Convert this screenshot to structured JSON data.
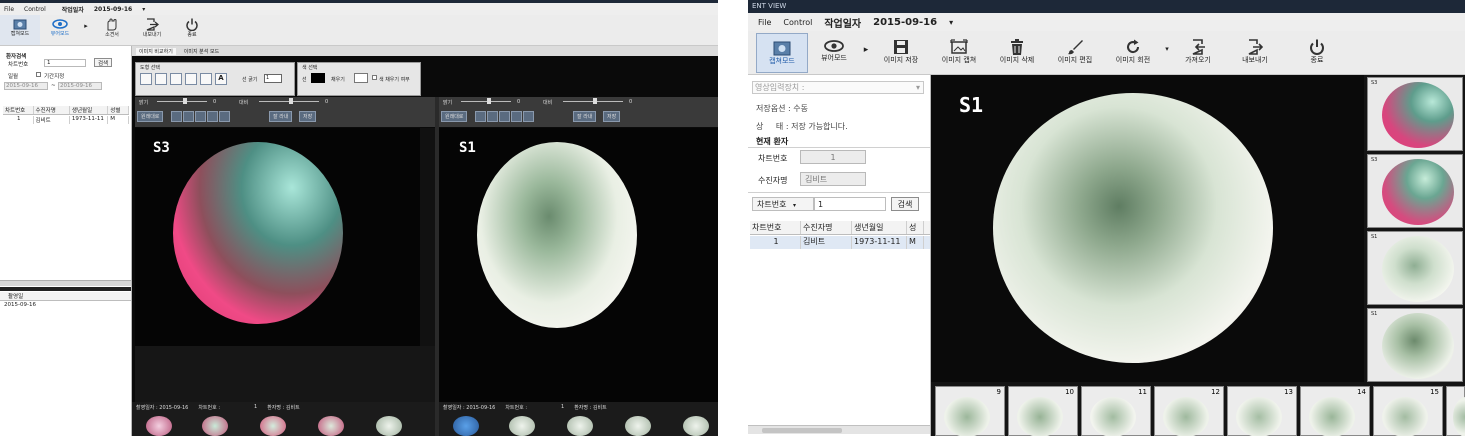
{
  "left_screen": {
    "menu": [
      "File",
      "Control"
    ],
    "work_date_label": "작업일자",
    "work_date_value": "2015-09-16",
    "toolbar": [
      {
        "label": "캡쳐모드",
        "icon": "capture-mode-icon"
      },
      {
        "label": "뷰어모드",
        "icon": "eye-icon"
      },
      {
        "label": "소견서",
        "icon": "hand-icon"
      },
      {
        "label": "내보내기",
        "icon": "export-icon"
      },
      {
        "label": "종료",
        "icon": "power-icon"
      }
    ],
    "tabs": [
      "이미지 비교하기",
      "이미지 분석 모드"
    ],
    "search": {
      "title": "환자검색",
      "chart_label": "차트번호",
      "chart_value": "1",
      "search_button": "검색",
      "date_label": "일월",
      "period_label": "기간지정",
      "date_from": "2015-09-16",
      "date_to": "2015-09-16"
    },
    "patient_table": {
      "headers": [
        "차트번호",
        "수진자명",
        "생년월일",
        "성별"
      ],
      "rows": [
        [
          "1",
          "김비트",
          "1973-11-11",
          "M"
        ]
      ]
    },
    "shoot_date": {
      "header": "촬영일",
      "value": "2015-09-16"
    },
    "shape_group": {
      "title": "도형 선택",
      "line_width_label": "선 굵기",
      "line_width_value": "1"
    },
    "color_group": {
      "title": "색 선택",
      "line_label": "선",
      "fill_label": "채우기",
      "fill_use_label": "색 채우기 여부"
    },
    "viewer_controls": {
      "brightness": "밝기",
      "contrast": "대비",
      "zero": "0",
      "reset": "원래대로",
      "cut": "잘 라내",
      "save": "저장"
    },
    "viewers": [
      {
        "label": "S3",
        "status_date": "촬영일자 : 2015-09-16",
        "status_chart": "차트번호 :",
        "status_no": "1",
        "status_patient": "환자명 : 김비트"
      },
      {
        "label": "S1",
        "status_date": "촬영일자 : 2015-09-16",
        "status_chart": "차트번호 :",
        "status_no": "1",
        "status_patient": "환자명 : 김비트"
      }
    ]
  },
  "right_screen": {
    "title": "ENT VIEW",
    "menu": [
      "File",
      "Control"
    ],
    "work_date_label": "작업일자",
    "work_date_value": "2015-09-16",
    "toolbar": [
      {
        "label": "캡쳐모드",
        "icon": "capture-mode-icon"
      },
      {
        "label": "뷰어모드",
        "icon": "eye-icon"
      },
      {
        "label": "이미지 저장",
        "icon": "save-icon"
      },
      {
        "label": "이미지 캡쳐",
        "icon": "image-capture-icon"
      },
      {
        "label": "이미지 삭제",
        "icon": "trash-icon"
      },
      {
        "label": "이미지 편집",
        "icon": "brush-icon"
      },
      {
        "label": "이미지 회전",
        "icon": "rotate-icon"
      },
      {
        "label": "가져오기",
        "icon": "import-icon"
      },
      {
        "label": "내보내기",
        "icon": "export-icon"
      },
      {
        "label": "종료",
        "icon": "power-icon"
      }
    ],
    "device_label": "영상입력장치 :",
    "save_option": "저장옵션 : 수동",
    "status_label": "상",
    "status_mid": "태 :",
    "status_value": "저장 가능합니다.",
    "current_patient": "현재 환자",
    "chart_label": "차트번호",
    "chart_value": "1",
    "name_label": "수진자명",
    "name_value": "김비트",
    "search_field": "차트번호",
    "search_value": "1",
    "search_button": "검색",
    "table": {
      "headers": [
        "차트번호",
        "수진자명",
        "생년월일",
        "성"
      ],
      "rows": [
        [
          "1",
          "김비트",
          "1973-11-11",
          "M"
        ]
      ]
    },
    "main_label": "S1",
    "side_thumbs": [
      "S3",
      "S3",
      "S1",
      "S1"
    ],
    "bottom_thumbs": [
      "9",
      "10",
      "11",
      "12",
      "13",
      "14",
      "15"
    ]
  },
  "colors": {
    "accent": "#1e6fc8",
    "dark_bg": "#0a0a0a",
    "title_bar": "#1d2838"
  }
}
